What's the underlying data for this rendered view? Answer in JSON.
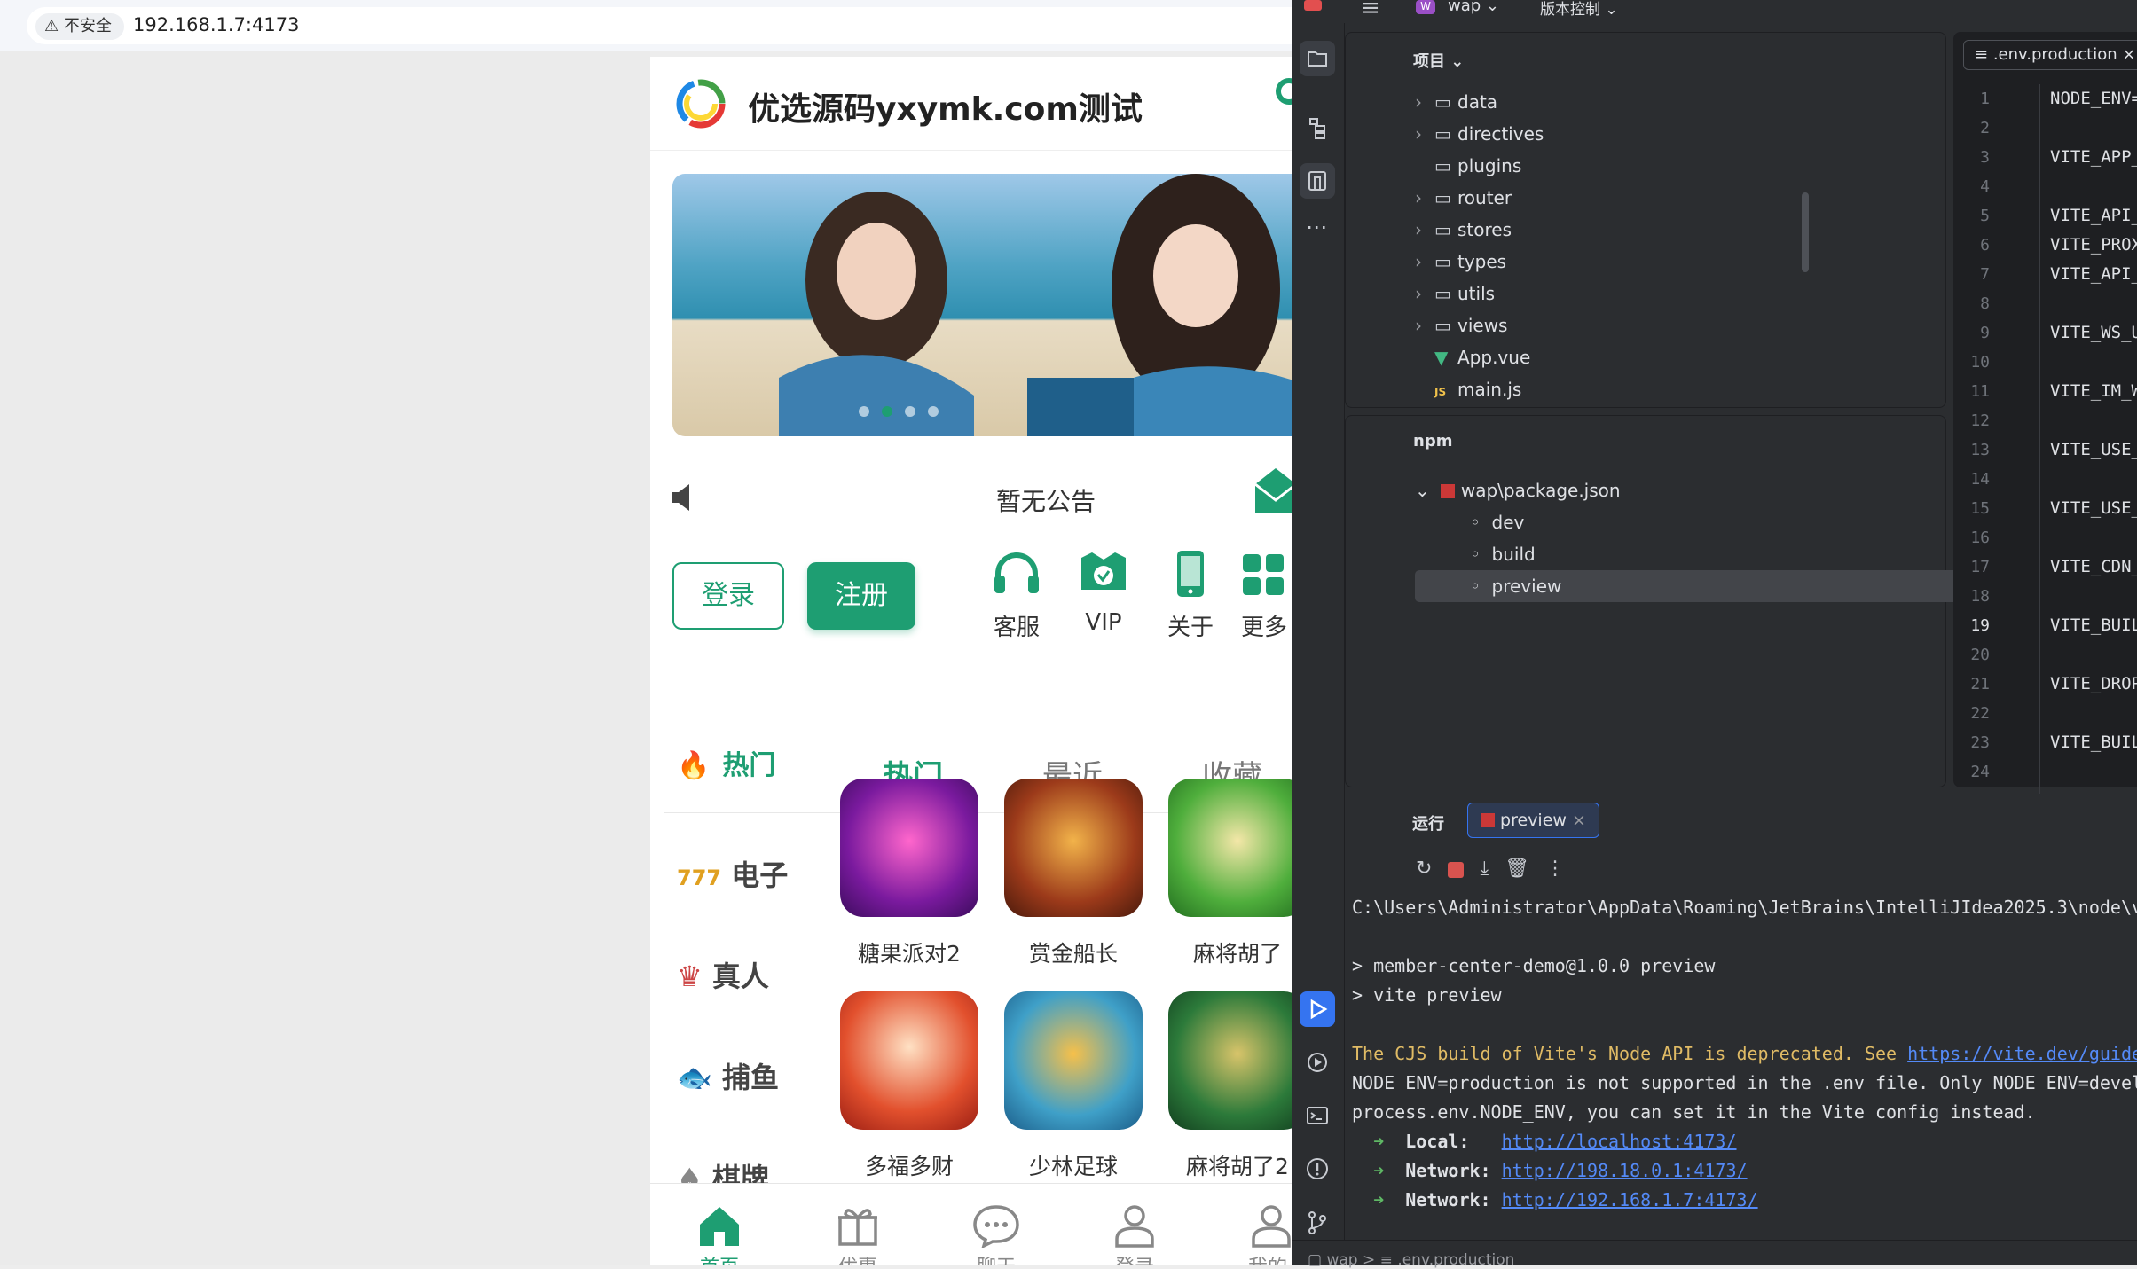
{
  "browser": {
    "security_label": "不安全",
    "url": "192.168.1.7:4173"
  },
  "site": {
    "title": "优选源码yxymk.com测试",
    "notice": "暂无公告",
    "login_label": "登录",
    "register_label": "注册",
    "quick": [
      {
        "label": "客服",
        "icon": "headset-icon"
      },
      {
        "label": "VIP",
        "icon": "vip-shield-icon"
      },
      {
        "label": "关于",
        "icon": "phone-icon"
      },
      {
        "label": "更多",
        "icon": "grid-icon"
      }
    ],
    "hot_label": "热门",
    "tabs": [
      "热门",
      "最近",
      "收藏"
    ],
    "categories": [
      "电子",
      "真人",
      "捕鱼",
      "棋牌"
    ],
    "games": [
      "糖果派对2",
      "赏金船长",
      "麻将胡了",
      "多福多财",
      "少林足球",
      "麻将胡了2"
    ],
    "nav": [
      {
        "label": "首页",
        "icon": "home-icon"
      },
      {
        "label": "优惠",
        "icon": "gift-icon"
      },
      {
        "label": "聊天室",
        "icon": "chat-icon"
      },
      {
        "label": "登录",
        "icon": "user-icon"
      },
      {
        "label": "我的",
        "icon": "profile-icon"
      }
    ],
    "accent": "#1e9e72"
  },
  "ide": {
    "project_name": "wap",
    "vcs_label": "版本控制",
    "project_panel_label": "项目",
    "tree": [
      {
        "name": "data",
        "type": "folder",
        "expandable": true
      },
      {
        "name": "directives",
        "type": "folder",
        "expandable": true
      },
      {
        "name": "plugins",
        "type": "folder",
        "expandable": false
      },
      {
        "name": "router",
        "type": "folder",
        "expandable": true
      },
      {
        "name": "stores",
        "type": "folder",
        "expandable": true
      },
      {
        "name": "types",
        "type": "folder",
        "expandable": true
      },
      {
        "name": "utils",
        "type": "folder",
        "expandable": true
      },
      {
        "name": "views",
        "type": "folder",
        "expandable": true
      },
      {
        "name": "App.vue",
        "type": "vue",
        "expandable": false
      },
      {
        "name": "main.js",
        "type": "js",
        "expandable": false
      }
    ],
    "npm_label": "npm",
    "npm_package": "wap\\package.json",
    "npm_scripts": [
      "dev",
      "build",
      "preview"
    ],
    "editor_tab": ".env.production",
    "code_lines": [
      "NODE_ENV=",
      "",
      "VITE_APP_",
      "",
      "VITE_API_",
      "VITE_PROX",
      "VITE_API_",
      "",
      "VITE_WS_U",
      "",
      "VITE_IM_W",
      "",
      "VITE_USE_",
      "",
      "VITE_USE_",
      "",
      "VITE_CDN_",
      "",
      "VITE_BUIL",
      "",
      "VITE_DROP",
      "",
      "VITE_BUIL",
      ""
    ],
    "current_line": 19,
    "run_label": "运行",
    "run_tab": "preview",
    "terminal": {
      "path": "C:\\Users\\Administrator\\AppData\\Roaming\\JetBrains\\IntelliJIdea2025.3\\node\\v",
      "cmd1": "> member-center-demo@1.0.0 preview",
      "cmd2": "> vite preview",
      "warn": "The CJS build of Vite's Node API is deprecated. See ",
      "warn_link": "https://vite.dev/guide",
      "err1": "NODE_ENV=production is not supported in the .env file. Only NODE_ENV=devel",
      "err2": "process.env.NODE_ENV, you can set it in the Vite config instead.",
      "local_label": "Local:",
      "local_url": "http://localhost:4173/",
      "net_label": "Network:",
      "net1": "http://198.18.0.1:4173/",
      "net2": "http://192.168.1.7:4173/"
    },
    "status_project": "wap",
    "status_file": ".env.production"
  }
}
